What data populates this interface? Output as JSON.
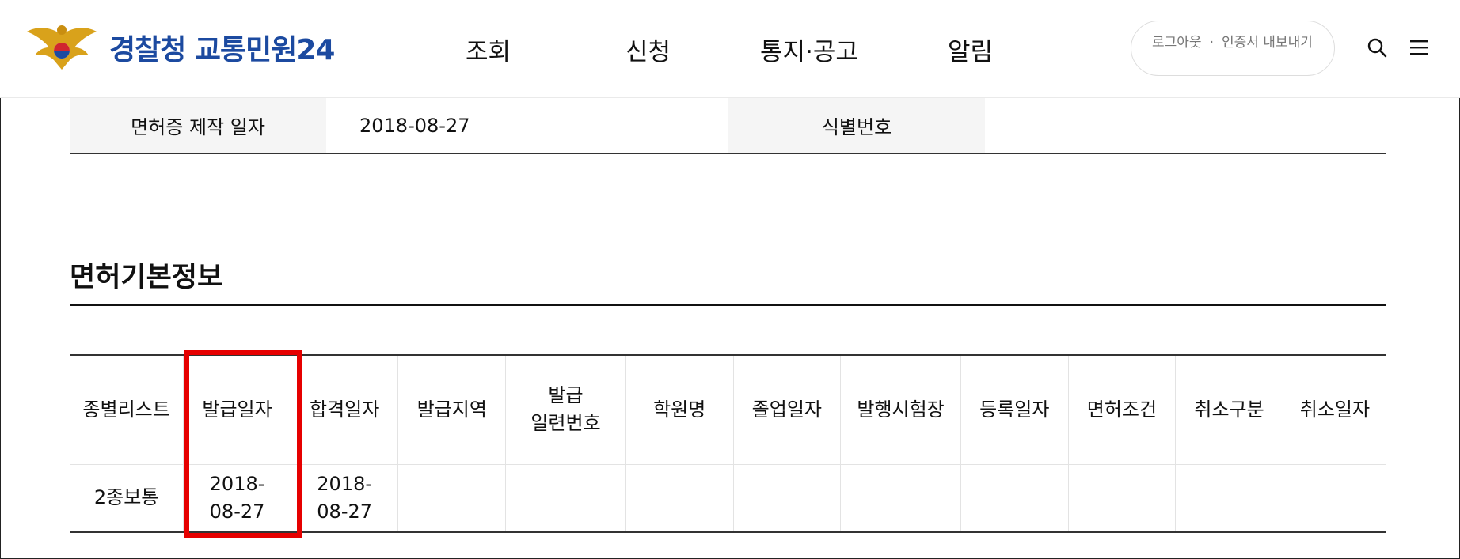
{
  "header": {
    "logo_text": "경찰청 교통민원24",
    "nav": [
      "조회",
      "신청",
      "통지·공고",
      "알림"
    ],
    "auth": {
      "logout": "로그아웃",
      "cert_export": "인증서 내보내기"
    }
  },
  "info_row": {
    "label_made_date": "면허증 제작 일자",
    "made_date": "2018-08-27",
    "label_id": "식별번호",
    "id_value": ""
  },
  "section": {
    "title": "면허기본정보"
  },
  "table": {
    "headers": [
      "종별리스트",
      "발급일자",
      "합격일자",
      "발급지역",
      "발급\n일련번호",
      "학원명",
      "졸업일자",
      "발행시험장",
      "등록일자",
      "면허조건",
      "취소구분",
      "취소일자"
    ],
    "rows": [
      [
        "2종보통",
        "2018-\n08-27",
        "2018-\n08-27",
        "",
        "",
        "",
        "",
        "",
        "",
        "",
        "",
        ""
      ]
    ]
  },
  "colors": {
    "brand": "#1c4aa0",
    "highlight": "#e60000",
    "logo_gold": "#d9a21b"
  }
}
